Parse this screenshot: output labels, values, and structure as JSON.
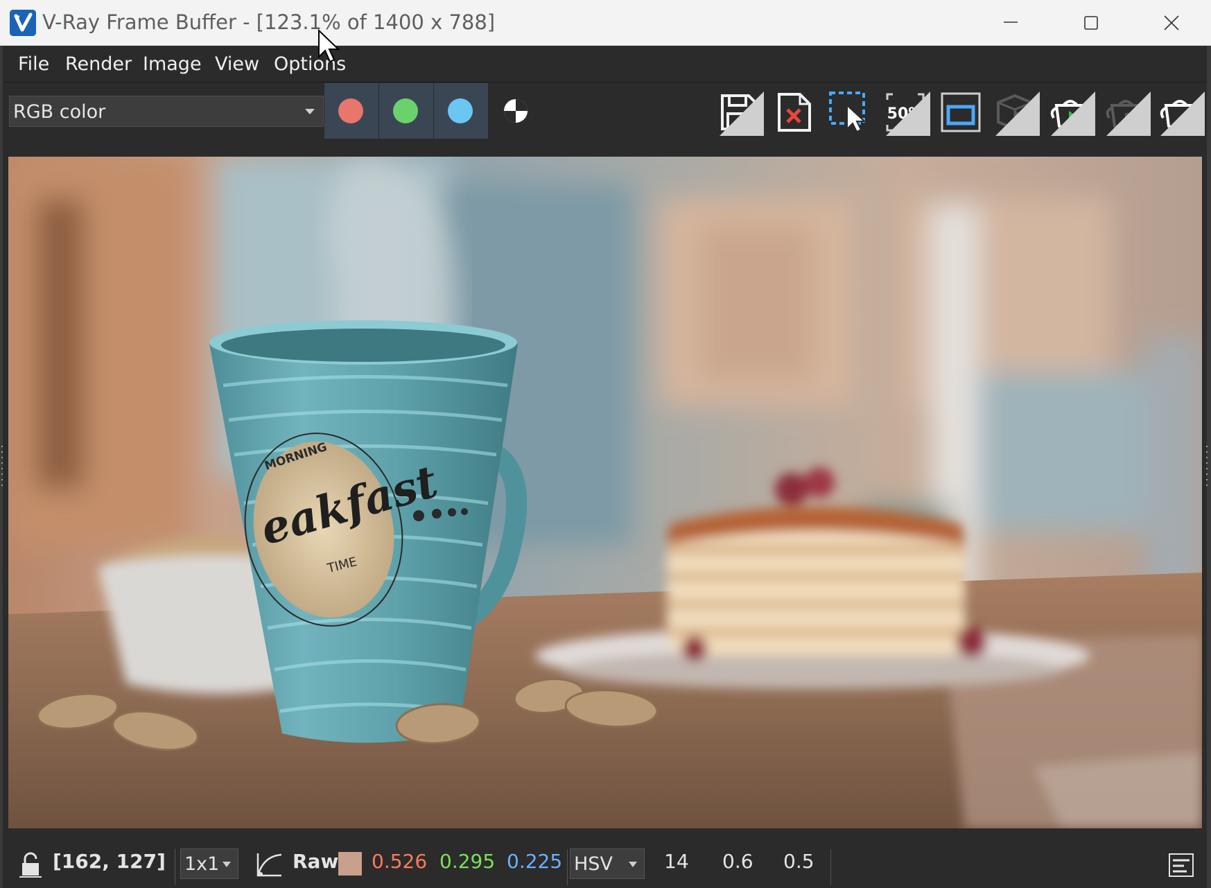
{
  "window": {
    "title": "V-Ray Frame Buffer - [123.1% of 1400 x 788]",
    "app_icon": "vray-logo-icon"
  },
  "menu": [
    {
      "label": "File"
    },
    {
      "label": "Render"
    },
    {
      "label": "Image"
    },
    {
      "label": "View"
    },
    {
      "label": "Options"
    }
  ],
  "toolbar": {
    "channel_select": "RGB color",
    "channels": [
      {
        "name": "red-channel",
        "color": "#e8766d"
      },
      {
        "name": "green-channel",
        "color": "#6ad26a"
      },
      {
        "name": "blue-channel",
        "color": "#6cc6f2"
      }
    ],
    "tools": [
      {
        "name": "save-image",
        "icon": "save-icon"
      },
      {
        "name": "clear-image",
        "icon": "clear-image-icon"
      },
      {
        "name": "region-render",
        "icon": "region-select-icon"
      },
      {
        "name": "zoom-50",
        "icon": "zoom-50-icon",
        "label": "50%"
      },
      {
        "name": "render-safe-frame",
        "icon": "safe-frame-icon"
      },
      {
        "name": "interactive-render",
        "icon": "interactive-render-icon"
      },
      {
        "name": "start-render",
        "icon": "teapot-render-icon"
      },
      {
        "name": "stop-render",
        "icon": "teapot-stop-icon"
      },
      {
        "name": "render-last",
        "icon": "teapot-icon"
      }
    ]
  },
  "render": {
    "mug_text_top": "MORNING",
    "mug_text_main": "eakfast",
    "mug_text_bottom": "TIME"
  },
  "status": {
    "coords": "[162, 127]",
    "sample_size": "1x1",
    "mode": "Raw",
    "swatch_color": "#c9a08b",
    "r": "0.526",
    "g": "0.295",
    "b": "0.225",
    "color_space": "HSV",
    "h": "14",
    "s": "0.6",
    "v": "0.5",
    "r_color": "#ff7a5c",
    "g_color": "#7ce05a",
    "b_color": "#6cb0ff"
  }
}
